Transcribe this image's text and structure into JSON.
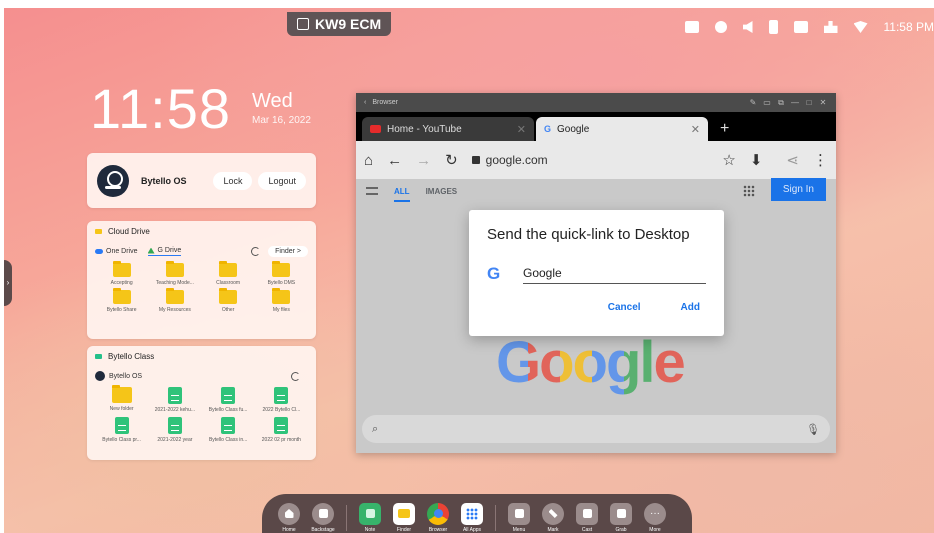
{
  "title_badge": "KW9 ECM",
  "status_bar": {
    "time": "11:58 PM",
    "icons": [
      "display-icon",
      "brightness-icon",
      "volume-icon",
      "usb-icon",
      "screen-share-icon",
      "network-icon",
      "wifi-icon"
    ]
  },
  "clock": {
    "time": "11:58",
    "day": "Wed",
    "date": "Mar 16, 2022"
  },
  "user_card": {
    "name": "Bytello OS",
    "lock_label": "Lock",
    "logout_label": "Logout"
  },
  "cloud_drive": {
    "title": "Cloud Drive",
    "tab_one_drive": "One Drive",
    "tab_g_drive": "G Drive",
    "finder_label": "Finder >",
    "folders": [
      "Accepting",
      "Teaching Mode...",
      "Classroom",
      "Bytello DMS",
      "Bytello Share",
      "My Resources",
      "Other",
      "My files"
    ]
  },
  "bytello_class": {
    "title": "Bytello Class",
    "user": "Bytello OS",
    "files": [
      "New folder",
      "2021-2022 kehu...",
      "Bytello Class fu...",
      "2022 Bytello Cl...",
      "Bytello Class pr...",
      "2021-2022 year",
      "Bytello Class in...",
      "2022 02 pr month"
    ]
  },
  "browser": {
    "window_title": "Browser",
    "tabs": [
      {
        "label": "Home - YouTube"
      },
      {
        "label": "Google"
      }
    ],
    "url": "google.com",
    "nav_all": "ALL",
    "nav_images": "IMAGES",
    "sign_in": "Sign In",
    "logo_text": "Google"
  },
  "dialog": {
    "title": "Send the quick-link to Desktop",
    "input_value": "Google",
    "cancel_label": "Cancel",
    "add_label": "Add"
  },
  "dock": {
    "items": [
      "Home",
      "Backstage",
      "Note",
      "Finder",
      "Browser",
      "All Apps",
      "Menu",
      "Mark",
      "Cast",
      "Grab",
      "More"
    ]
  },
  "colors": {
    "accent": "#1a73e8",
    "dock_bg": "#5a4848",
    "folder": "#f5c518",
    "class_file": "#2fc37a"
  }
}
